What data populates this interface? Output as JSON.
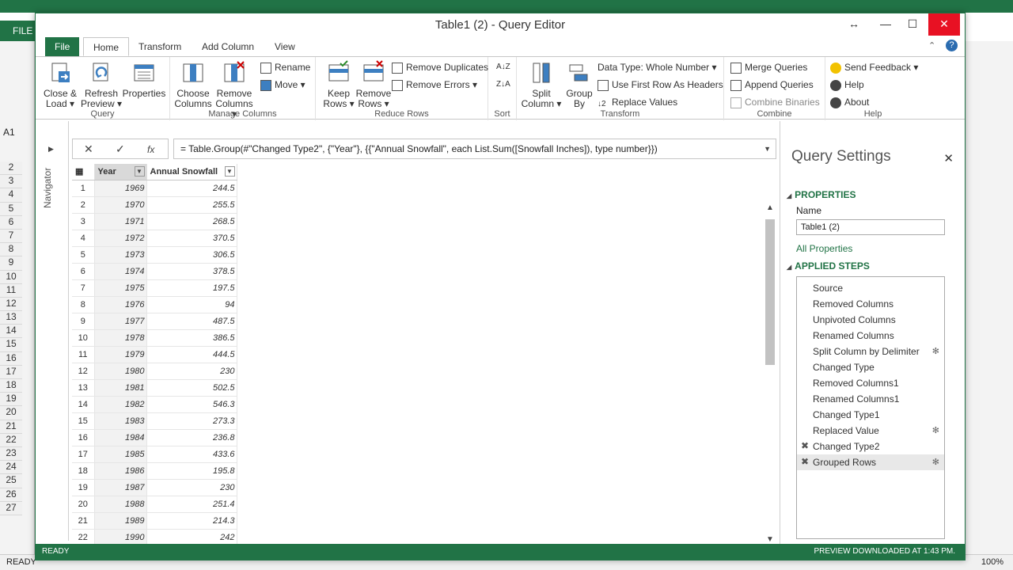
{
  "excel": {
    "file_tab": "FILE",
    "name_box": "A1",
    "status_left": "READY",
    "zoom": "100%",
    "row_numbers": [
      "2",
      "3",
      "4",
      "5",
      "6",
      "7",
      "8",
      "9",
      "10",
      "11",
      "12",
      "13",
      "14",
      "15",
      "16",
      "17",
      "18",
      "19",
      "20",
      "21",
      "22",
      "23",
      "24",
      "25",
      "26",
      "27"
    ]
  },
  "window": {
    "title": "Table1 (2) - Query Editor"
  },
  "tabs": [
    "File",
    "Home",
    "Transform",
    "Add Column",
    "View"
  ],
  "ribbon": {
    "query": {
      "label": "Query",
      "close_load": [
        "Close &",
        "Load"
      ],
      "refresh": [
        "Refresh",
        "Preview"
      ],
      "properties": "Properties"
    },
    "manage_columns": {
      "label": "Manage Columns",
      "choose": [
        "Choose",
        "Columns"
      ],
      "remove": [
        "Remove",
        "Columns"
      ],
      "rename": "Rename",
      "move": "Move"
    },
    "reduce_rows": {
      "label": "Reduce Rows",
      "keep": [
        "Keep",
        "Rows"
      ],
      "remove": [
        "Remove",
        "Rows"
      ],
      "remove_duplicates": "Remove Duplicates",
      "remove_errors": "Remove Errors"
    },
    "sort": {
      "label": "Sort"
    },
    "transform": {
      "label": "Transform",
      "split": [
        "Split",
        "Column"
      ],
      "group": [
        "Group",
        "By"
      ],
      "data_type": "Data Type: Whole Number",
      "first_row": "Use First Row As Headers",
      "replace": "Replace Values"
    },
    "combine": {
      "label": "Combine",
      "merge": "Merge Queries",
      "append": "Append Queries",
      "binaries": "Combine Binaries"
    },
    "help": {
      "label": "Help",
      "feedback": "Send Feedback",
      "help": "Help",
      "about": "About"
    }
  },
  "navigator": {
    "label": "Navigator"
  },
  "formula": "= Table.Group(#\"Changed Type2\", {\"Year\"}, {{\"Annual Snowfall\", each List.Sum([Snowfall Inches]), type number}})",
  "table": {
    "columns": [
      "Year",
      "Annual Snowfall"
    ],
    "rows": [
      [
        "1",
        "1969",
        "244.5"
      ],
      [
        "2",
        "1970",
        "255.5"
      ],
      [
        "3",
        "1971",
        "268.5"
      ],
      [
        "4",
        "1972",
        "370.5"
      ],
      [
        "5",
        "1973",
        "306.5"
      ],
      [
        "6",
        "1974",
        "378.5"
      ],
      [
        "7",
        "1975",
        "197.5"
      ],
      [
        "8",
        "1976",
        "94"
      ],
      [
        "9",
        "1977",
        "487.5"
      ],
      [
        "10",
        "1978",
        "386.5"
      ],
      [
        "11",
        "1979",
        "444.5"
      ],
      [
        "12",
        "1980",
        "230"
      ],
      [
        "13",
        "1981",
        "502.5"
      ],
      [
        "14",
        "1982",
        "546.3"
      ],
      [
        "15",
        "1983",
        "273.3"
      ],
      [
        "16",
        "1984",
        "236.8"
      ],
      [
        "17",
        "1985",
        "433.6"
      ],
      [
        "18",
        "1986",
        "195.8"
      ],
      [
        "19",
        "1987",
        "230"
      ],
      [
        "20",
        "1988",
        "251.4"
      ],
      [
        "21",
        "1989",
        "214.3"
      ],
      [
        "22",
        "1990",
        "242"
      ]
    ]
  },
  "query_settings": {
    "title": "Query Settings",
    "properties_header": "PROPERTIES",
    "name_label": "Name",
    "name_value": "Table1 (2)",
    "all_properties": "All Properties",
    "steps_header": "APPLIED STEPS",
    "steps": [
      {
        "label": "Source",
        "gear": false,
        "x": false
      },
      {
        "label": "Removed Columns",
        "gear": false,
        "x": false
      },
      {
        "label": "Unpivoted Columns",
        "gear": false,
        "x": false
      },
      {
        "label": "Renamed Columns",
        "gear": false,
        "x": false
      },
      {
        "label": "Split Column by Delimiter",
        "gear": true,
        "x": false
      },
      {
        "label": "Changed Type",
        "gear": false,
        "x": false
      },
      {
        "label": "Removed Columns1",
        "gear": false,
        "x": false
      },
      {
        "label": "Renamed Columns1",
        "gear": false,
        "x": false
      },
      {
        "label": "Changed Type1",
        "gear": false,
        "x": false
      },
      {
        "label": "Replaced Value",
        "gear": true,
        "x": false
      },
      {
        "label": "Changed Type2",
        "gear": false,
        "x": true
      },
      {
        "label": "Grouped Rows",
        "gear": true,
        "x": true,
        "selected": true
      }
    ]
  },
  "status": {
    "left": "READY",
    "right": "PREVIEW DOWNLOADED AT 1:43 PM."
  },
  "colors": {
    "accent": "#217346",
    "close": "#e81123"
  }
}
